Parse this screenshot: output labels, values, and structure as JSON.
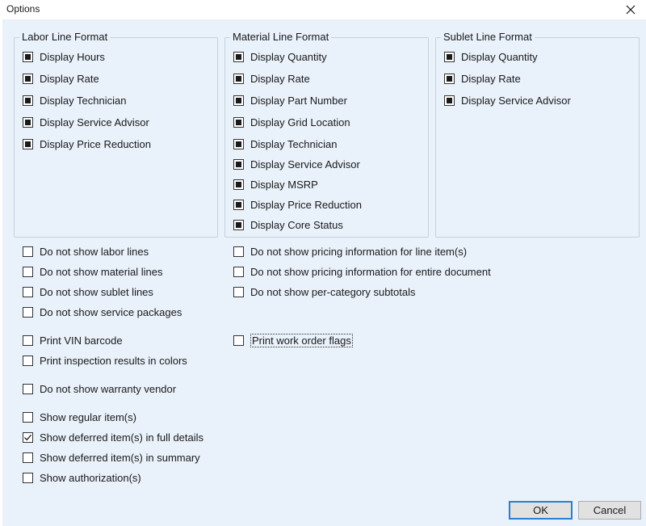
{
  "window": {
    "title": "Options"
  },
  "labor_group": {
    "title": "Labor Line Format",
    "items": [
      "Display Hours",
      "Display Rate",
      "Display Technician",
      "Display Service Advisor",
      "Display Price Reduction"
    ]
  },
  "material_group": {
    "title": "Material Line Format",
    "items": [
      "Display Quantity",
      "Display Rate",
      "Display Part Number",
      "Display Grid Location",
      "Display Technician",
      "Display Service Advisor",
      "Display MSRP",
      "Display Price Reduction",
      "Display Core Status"
    ]
  },
  "sublet_group": {
    "title": "Sublet Line Format",
    "items": [
      "Display Quantity",
      "Display Rate",
      "Display Service Advisor"
    ]
  },
  "options_left": [
    "Do not show labor lines",
    "Do not show material lines",
    "Do not show sublet lines",
    "Do not show service packages",
    "Print VIN barcode",
    "Print inspection results in colors",
    "Do not show warranty vendor",
    "Show regular item(s)",
    "Show deferred item(s) in full details",
    "Show deferred item(s) in summary",
    "Show authorization(s)"
  ],
  "options_right": [
    "Do not show pricing information for line item(s)",
    "Do not show pricing information for entire document",
    "Do not show per-category subtotals",
    "Print work order flags"
  ],
  "checked_state": {
    "labor": [
      true,
      true,
      true,
      true,
      true
    ],
    "material": [
      true,
      true,
      true,
      true,
      true,
      true,
      true,
      true,
      true
    ],
    "sublet": [
      true,
      true,
      true
    ],
    "options_left": [
      false,
      false,
      false,
      false,
      false,
      false,
      false,
      false,
      true,
      false,
      false
    ],
    "options_right": [
      false,
      false,
      false,
      false
    ]
  },
  "buttons": {
    "ok": "OK",
    "cancel": "Cancel"
  },
  "icons": {
    "close": "close-icon",
    "check": "checkmark-icon"
  }
}
